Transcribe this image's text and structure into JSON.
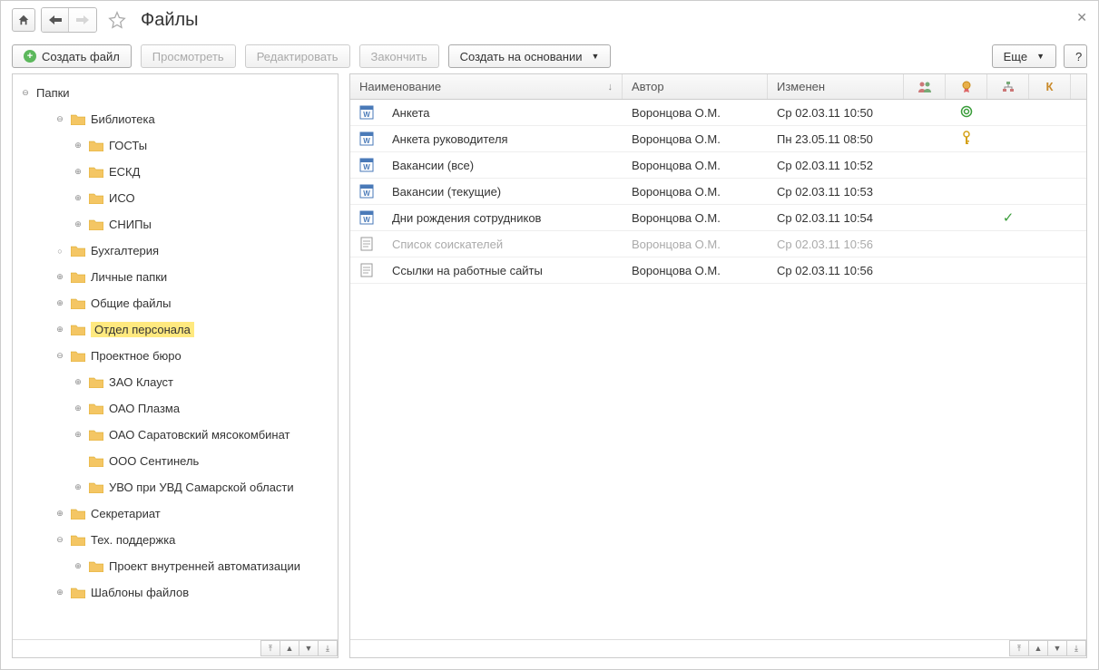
{
  "title": "Файлы",
  "toolbar": {
    "create": "Создать файл",
    "view": "Просмотреть",
    "edit": "Редактировать",
    "finish": "Закончить",
    "createFrom": "Создать на основании",
    "more": "Еще",
    "help": "?"
  },
  "tree": {
    "root": "Папки",
    "items": [
      {
        "level": 1,
        "label": "Библиотека",
        "expand": "minus",
        "icon": true
      },
      {
        "level": 2,
        "label": "ГОСТы",
        "expand": "plus",
        "icon": true
      },
      {
        "level": 2,
        "label": "ЕСКД",
        "expand": "plus",
        "icon": true
      },
      {
        "level": 2,
        "label": "ИСО",
        "expand": "plus",
        "icon": true
      },
      {
        "level": 2,
        "label": "СНИПы",
        "expand": "plus",
        "icon": true
      },
      {
        "level": 1,
        "label": "Бухгалтерия",
        "expand": "dot",
        "icon": true
      },
      {
        "level": 1,
        "label": "Личные папки",
        "expand": "plus",
        "icon": true
      },
      {
        "level": 1,
        "label": "Общие файлы",
        "expand": "plus",
        "icon": true
      },
      {
        "level": 1,
        "label": "Отдел персонала",
        "expand": "plus",
        "icon": true,
        "selected": true
      },
      {
        "level": 1,
        "label": "Проектное бюро",
        "expand": "minus",
        "icon": true
      },
      {
        "level": 2,
        "label": "ЗАО Клауст",
        "expand": "plus",
        "icon": true
      },
      {
        "level": 2,
        "label": "ОАО Плазма",
        "expand": "plus",
        "icon": true
      },
      {
        "level": 2,
        "label": "ОАО Саратовский мясокомбинат",
        "expand": "plus",
        "icon": true
      },
      {
        "level": 2,
        "label": "ООО Сентинель",
        "expand": "none",
        "icon": true
      },
      {
        "level": 2,
        "label": "УВО при УВД Самарской области",
        "expand": "plus",
        "icon": true
      },
      {
        "level": 1,
        "label": "Секретариат",
        "expand": "plus",
        "icon": true
      },
      {
        "level": 1,
        "label": "Тех. поддержка",
        "expand": "minus",
        "icon": true
      },
      {
        "level": 2,
        "label": "Проект внутренней автоматизации",
        "expand": "plus",
        "icon": true
      },
      {
        "level": 1,
        "label": "Шаблоны файлов",
        "expand": "plus",
        "icon": true
      }
    ]
  },
  "table": {
    "headers": {
      "name": "Наименование",
      "author": "Автор",
      "modified": "Изменен",
      "col4": "",
      "col5": "",
      "col6": "",
      "col7": "К"
    },
    "rows": [
      {
        "icon": "word",
        "name": "Анкета",
        "author": "Воронцова О.М.",
        "modified": "Ср 02.03.11 10:50",
        "signed": true
      },
      {
        "icon": "word",
        "name": "Анкета руководителя",
        "author": "Воронцова О.М.",
        "modified": "Пн 23.05.11 08:50",
        "encrypted": true
      },
      {
        "icon": "word",
        "name": "Вакансии (все)",
        "author": "Воронцова О.М.",
        "modified": "Ср 02.03.11 10:52"
      },
      {
        "icon": "word",
        "name": "Вакансии (текущие)",
        "author": "Воронцова О.М.",
        "modified": "Ср 02.03.11 10:53"
      },
      {
        "icon": "word",
        "name": "Дни рождения сотрудников",
        "author": "Воронцова О.М.",
        "modified": "Ср 02.03.11 10:54",
        "checked": true
      },
      {
        "icon": "text",
        "name": "Список соискателей",
        "author": "Воронцова О.М.",
        "modified": "Ср 02.03.11 10:56",
        "disabled": true
      },
      {
        "icon": "text",
        "name": "Ссылки на работные сайты",
        "author": "Воронцова О.М.",
        "modified": "Ср 02.03.11 10:56"
      }
    ]
  }
}
